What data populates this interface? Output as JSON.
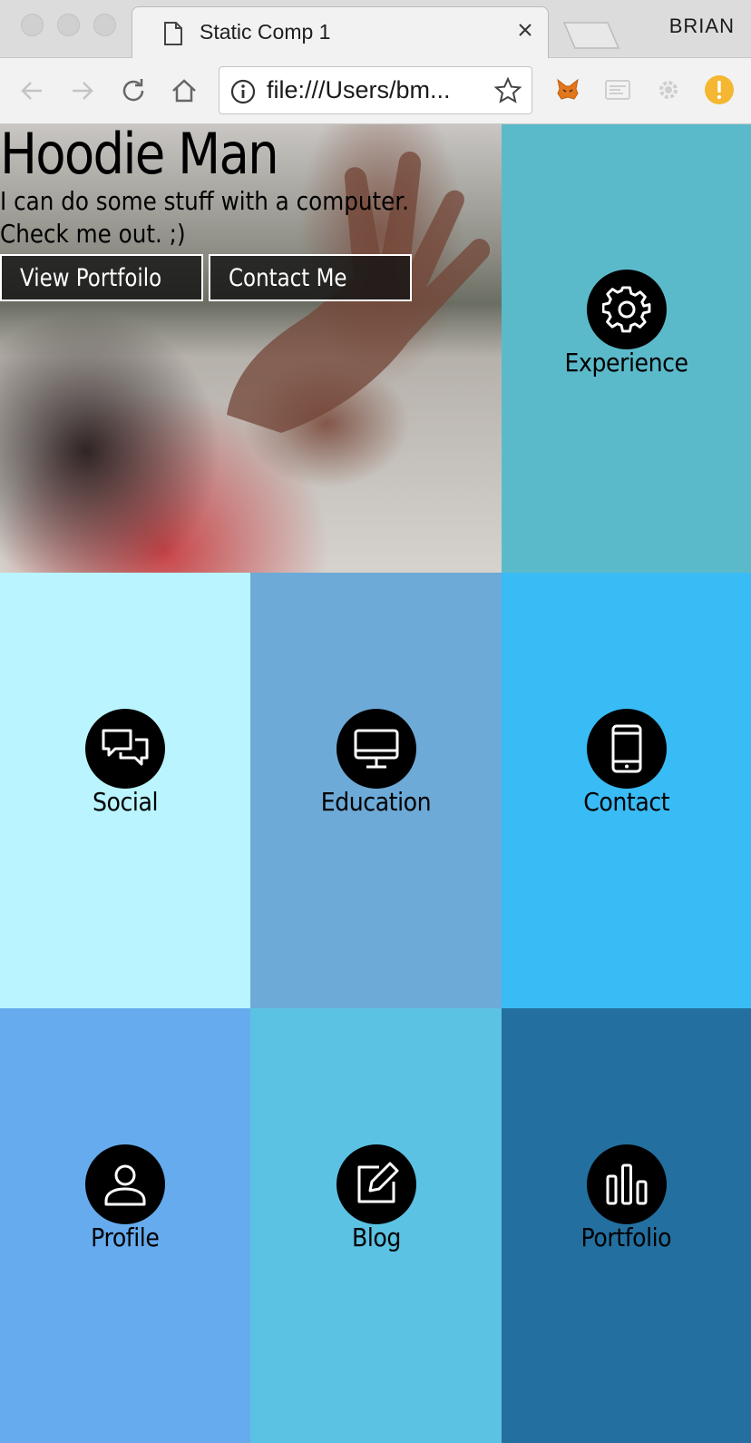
{
  "window": {
    "tab_title": "Static Comp 1",
    "profile_name": "BRIAN"
  },
  "toolbar": {
    "url": "file:///Users/bm...",
    "icons": [
      "back-icon",
      "forward-icon",
      "reload-icon",
      "home-icon",
      "info-icon",
      "star-icon"
    ],
    "extensions": [
      "metamask-fox-icon",
      "cast-icon",
      "settings-extension-icon",
      "alert-extension-icon"
    ]
  },
  "hero": {
    "title": "Hoodie Man",
    "subtitle": "I can do some stuff with a computer. Check me out. ;)",
    "buttons": {
      "portfolio": "View Portfoilo",
      "contact": "Contact Me"
    }
  },
  "tiles": {
    "experience": {
      "label": "Experience",
      "icon": "gear-icon",
      "color": "#5bbaca"
    },
    "social": {
      "label": "Social",
      "icon": "chat-bubbles-icon",
      "color": "#baf5ff"
    },
    "education": {
      "label": "Education",
      "icon": "desktop-icon",
      "color": "#6eaad7"
    },
    "contact": {
      "label": "Contact",
      "icon": "mobile-phone-icon",
      "color": "#39bcf5"
    },
    "profile": {
      "label": "Profile",
      "icon": "user-icon",
      "color": "#66abee"
    },
    "blog": {
      "label": "Blog",
      "icon": "edit-icon",
      "color": "#5bc2e3"
    },
    "portfolio": {
      "label": "Portfolio",
      "icon": "bar-chart-icon",
      "color": "#2370a0"
    }
  }
}
